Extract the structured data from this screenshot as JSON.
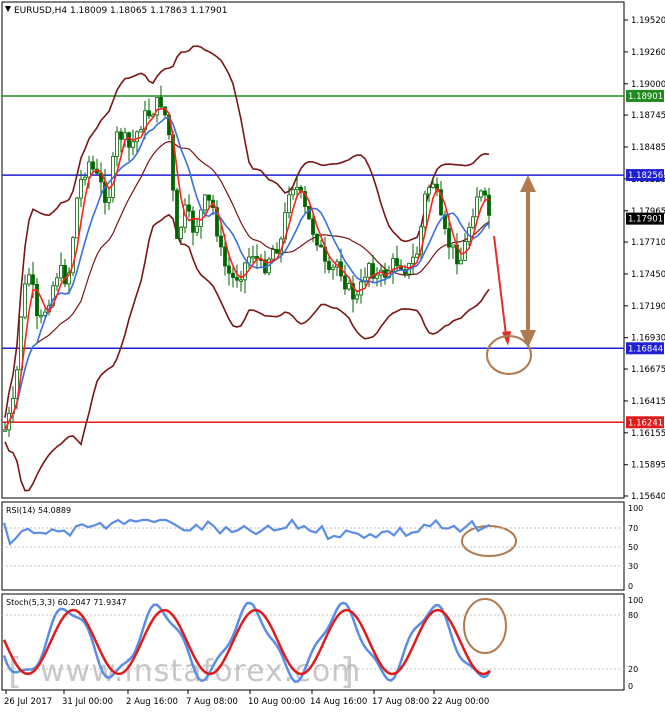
{
  "window": {
    "symbol_line": "EURUSD,H4  1.18009 1.18065 1.17863 1.17901"
  },
  "price_axis": {
    "ticks": [
      "1.19520",
      "1.19260",
      "1.19000",
      "1.18745",
      "1.18485",
      "1.18225",
      "1.17965",
      "1.17710",
      "1.17450",
      "1.17190",
      "1.16930",
      "1.16675",
      "1.16415",
      "1.16155",
      "1.15895",
      "1.15640"
    ]
  },
  "levels": [
    {
      "name": "resistance-1",
      "label": "1.18901",
      "color": "#1f8b1f"
    },
    {
      "name": "resistance-2",
      "label": "1.18256",
      "color": "#1f1fd6"
    },
    {
      "name": "current-price",
      "label": "1.17901",
      "color": "#000000"
    },
    {
      "name": "support-1",
      "label": "1.16844",
      "color": "#1f1fd6"
    },
    {
      "name": "support-2",
      "label": "1.16241",
      "color": "#e01b1b"
    }
  ],
  "rsi": {
    "label": "RSI(14) 54.0889",
    "ticks": [
      "100",
      "70",
      "50",
      "30",
      "0"
    ]
  },
  "stoch": {
    "label": "Stoch(5,3,3) 60.2047 71.9347",
    "ticks": [
      "100",
      "80",
      "20",
      "0"
    ]
  },
  "time_axis": {
    "labels": [
      "26 Jul 2017",
      "31 Jul 00:00",
      "2 Aug 16:00",
      "7 Aug 08:00",
      "10 Aug 00:00",
      "14 Aug 16:00",
      "17 Aug 08:00",
      "22 Aug 00:00"
    ]
  },
  "watermark": "www.instaforex.com",
  "colors": {
    "candles": "#006400",
    "bollinger": "#7a1515",
    "ma_fast": "#ff2020",
    "ma_slow": "#3a6fe0",
    "annotation": "#b07a50",
    "arrow_red": "#e62b2b"
  }
}
